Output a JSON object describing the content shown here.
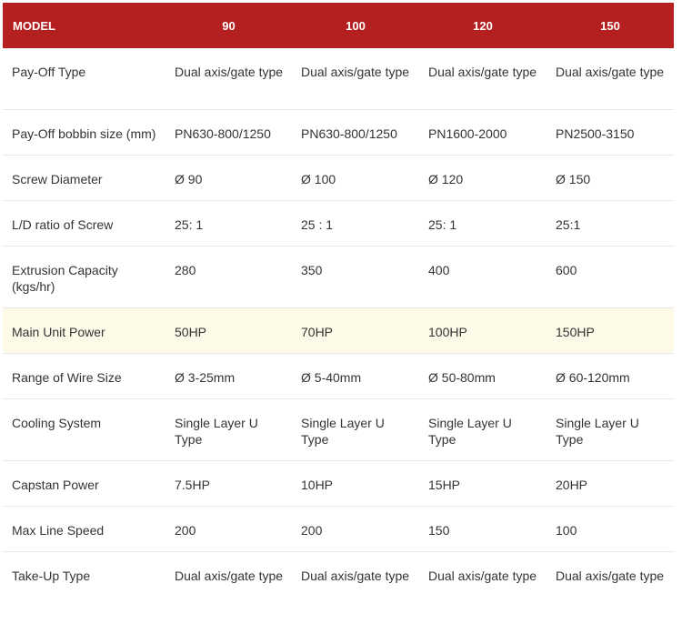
{
  "table": {
    "headers": [
      "MODEL",
      "90",
      "100",
      "120",
      "150"
    ],
    "rows": [
      {
        "label": "Pay-Off Type",
        "values": [
          "Dual axis/gate type",
          "Dual axis/gate type",
          "Dual axis/gate type",
          "Dual axis/gate type"
        ]
      },
      {
        "label": "Pay-Off bobbin size (mm)",
        "values": [
          "PN630-800/1250",
          "PN630-800/1250",
          "PN1600-2000",
          "PN2500-3150"
        ]
      },
      {
        "label": "Screw Diameter",
        "values": [
          "Ø 90",
          "Ø 100",
          "Ø 120",
          "Ø 150"
        ]
      },
      {
        "label": "L/D ratio of Screw",
        "values": [
          "25: 1",
          "25 : 1",
          "25: 1",
          "25:1"
        ]
      },
      {
        "label": "Extrusion Capacity (kgs/hr)",
        "values": [
          "280",
          "350",
          "400",
          "600"
        ]
      },
      {
        "label": "Main Unit Power",
        "values": [
          "50HP",
          "70HP",
          "100HP",
          "150HP"
        ]
      },
      {
        "label": "Range of Wire Size",
        "values": [
          "Ø 3-25mm",
          "Ø 5-40mm",
          "Ø 50-80mm",
          "Ø 60-120mm"
        ]
      },
      {
        "label": "Cooling System",
        "values": [
          "Single Layer U Type",
          "Single Layer U Type",
          "Single Layer U Type",
          "Single Layer U Type"
        ]
      },
      {
        "label": "Capstan Power",
        "values": [
          "7.5HP",
          "10HP",
          "15HP",
          "20HP"
        ]
      },
      {
        "label": "Max Line Speed",
        "values": [
          "200",
          "200",
          "150",
          "100"
        ]
      },
      {
        "label": "Take-Up Type",
        "values": [
          "Dual axis/gate type",
          "Dual axis/gate type",
          "Dual axis/gate type",
          "Dual axis/gate type"
        ]
      }
    ]
  },
  "colors": {
    "header_bg": "#b3201f",
    "header_text": "#ffffff",
    "highlight_row_bg": "#fdfbe8"
  }
}
